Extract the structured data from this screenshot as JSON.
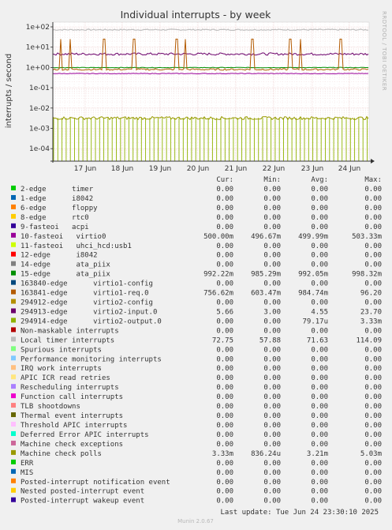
{
  "chart_data": {
    "type": "line",
    "title": "Individual interrupts - by week",
    "ylabel": "interrupts / second",
    "xlabel": "",
    "yscale": "log",
    "ylim": [
      3e-05,
      200
    ],
    "ytick_labels": [
      "1e+02",
      "1e+01",
      "1e+00",
      "1e-01",
      "1e-02",
      "1e-03",
      "1e-04"
    ],
    "ytick_values": [
      100,
      10,
      1,
      0.1,
      0.01,
      0.001,
      0.0001
    ],
    "categories": [
      "17 Jun",
      "18 Jun",
      "19 Jun",
      "20 Jun",
      "21 Jun",
      "22 Jun",
      "23 Jun",
      "24 Jun"
    ],
    "grid": true,
    "side_label": "RRDTOOL / TOBI OETIKER",
    "columns": [
      "Cur:",
      "Min:",
      "Avg:",
      "Max:"
    ],
    "series": [
      {
        "name": "2-edge      timer",
        "color": "#00cc00",
        "cur": "0.00",
        "min": "0.00",
        "avg": "0.00",
        "max": "0.00"
      },
      {
        "name": "1-edge      i8042",
        "color": "#0066b3",
        "cur": "0.00",
        "min": "0.00",
        "avg": "0.00",
        "max": "0.00"
      },
      {
        "name": "6-edge      floppy",
        "color": "#ff8000",
        "cur": "0.00",
        "min": "0.00",
        "avg": "0.00",
        "max": "0.00"
      },
      {
        "name": "8-edge      rtc0",
        "color": "#ffcc00",
        "cur": "0.00",
        "min": "0.00",
        "avg": "0.00",
        "max": "0.00"
      },
      {
        "name": "9-fasteoi   acpi",
        "color": "#330099",
        "cur": "0.00",
        "min": "0.00",
        "avg": "0.00",
        "max": "0.00"
      },
      {
        "name": "10-fasteoi   virtio0",
        "color": "#990099",
        "cur": "500.00m",
        "min": "496.67m",
        "avg": "499.99m",
        "max": "503.33m"
      },
      {
        "name": "11-fasteoi   uhci_hcd:usb1",
        "color": "#ccff00",
        "cur": "0.00",
        "min": "0.00",
        "avg": "0.00",
        "max": "0.00"
      },
      {
        "name": "12-edge      i8042",
        "color": "#ff0000",
        "cur": "0.00",
        "min": "0.00",
        "avg": "0.00",
        "max": "0.00"
      },
      {
        "name": "14-edge      ata_piix",
        "color": "#808080",
        "cur": "0.00",
        "min": "0.00",
        "avg": "0.00",
        "max": "0.00"
      },
      {
        "name": "15-edge      ata_piix",
        "color": "#008f00",
        "cur": "992.22m",
        "min": "985.29m",
        "avg": "992.05m",
        "max": "998.32m"
      },
      {
        "name": "163840-edge      virtio1-config",
        "color": "#00487d",
        "cur": "0.00",
        "min": "0.00",
        "avg": "0.00",
        "max": "0.00"
      },
      {
        "name": "163841-edge      virtio1-req.0",
        "color": "#b35a00",
        "cur": "756.62m",
        "min": "603.47m",
        "avg": "984.74m",
        "max": "96.20"
      },
      {
        "name": "294912-edge      virtio2-config",
        "color": "#b38f00",
        "cur": "0.00",
        "min": "0.00",
        "avg": "0.00",
        "max": "0.00"
      },
      {
        "name": "294913-edge      virtio2-input.0",
        "color": "#6b006b",
        "cur": "5.66",
        "min": "3.00",
        "avg": "4.55",
        "max": "23.70"
      },
      {
        "name": "294914-edge      virtio2-output.0",
        "color": "#8fb300",
        "cur": "0.00",
        "min": "0.00",
        "avg": "79.17u",
        "max": "3.33m"
      },
      {
        "name": "Non-maskable interrupts",
        "color": "#b30000",
        "cur": "0.00",
        "min": "0.00",
        "avg": "0.00",
        "max": "0.00"
      },
      {
        "name": "Local timer interrupts",
        "color": "#bebebe",
        "cur": "72.75",
        "min": "57.88",
        "avg": "71.63",
        "max": "114.09"
      },
      {
        "name": "Spurious interrupts",
        "color": "#80ff80",
        "cur": "0.00",
        "min": "0.00",
        "avg": "0.00",
        "max": "0.00"
      },
      {
        "name": "Performance monitoring interrupts",
        "color": "#80c9ff",
        "cur": "0.00",
        "min": "0.00",
        "avg": "0.00",
        "max": "0.00"
      },
      {
        "name": "IRQ work interrupts",
        "color": "#ffc080",
        "cur": "0.00",
        "min": "0.00",
        "avg": "0.00",
        "max": "0.00"
      },
      {
        "name": "APIC ICR read retries",
        "color": "#ffe680",
        "cur": "0.00",
        "min": "0.00",
        "avg": "0.00",
        "max": "0.00"
      },
      {
        "name": "Rescheduling interrupts",
        "color": "#aa80ff",
        "cur": "0.00",
        "min": "0.00",
        "avg": "0.00",
        "max": "0.00"
      },
      {
        "name": "Function call interrupts",
        "color": "#ee00cc",
        "cur": "0.00",
        "min": "0.00",
        "avg": "0.00",
        "max": "0.00"
      },
      {
        "name": "TLB shootdowns",
        "color": "#ff8080",
        "cur": "0.00",
        "min": "0.00",
        "avg": "0.00",
        "max": "0.00"
      },
      {
        "name": "Thermal event interrupts",
        "color": "#666600",
        "cur": "0.00",
        "min": "0.00",
        "avg": "0.00",
        "max": "0.00"
      },
      {
        "name": "Threshold APIC interrupts",
        "color": "#ffbfff",
        "cur": "0.00",
        "min": "0.00",
        "avg": "0.00",
        "max": "0.00"
      },
      {
        "name": "Deferred Error APIC interrupts",
        "color": "#00ffcc",
        "cur": "0.00",
        "min": "0.00",
        "avg": "0.00",
        "max": "0.00"
      },
      {
        "name": "Machine check exceptions",
        "color": "#cc6699",
        "cur": "0.00",
        "min": "0.00",
        "avg": "0.00",
        "max": "0.00"
      },
      {
        "name": "Machine check polls",
        "color": "#999900",
        "cur": "3.33m",
        "min": "836.24u",
        "avg": "3.21m",
        "max": "5.03m"
      },
      {
        "name": "ERR",
        "color": "#00cc00",
        "cur": "0.00",
        "min": "0.00",
        "avg": "0.00",
        "max": "0.00"
      },
      {
        "name": "MIS",
        "color": "#0066b3",
        "cur": "0.00",
        "min": "0.00",
        "avg": "0.00",
        "max": "0.00"
      },
      {
        "name": "Posted-interrupt notification event",
        "color": "#ff8000",
        "cur": "0.00",
        "min": "0.00",
        "avg": "0.00",
        "max": "0.00"
      },
      {
        "name": "Nested posted-interrupt event",
        "color": "#ffcc00",
        "cur": "0.00",
        "min": "0.00",
        "avg": "0.00",
        "max": "0.00"
      },
      {
        "name": "Posted-interrupt wakeup event",
        "color": "#330099",
        "cur": "0.00",
        "min": "0.00",
        "avg": "0.00",
        "max": "0.00"
      }
    ],
    "plotted_lines": [
      {
        "label": "Local timer interrupts",
        "level": 72,
        "color": "#bebebe"
      },
      {
        "label": "294913-edge virtio2-input.0",
        "level": 4.6,
        "color": "#6b006b"
      },
      {
        "label": "15-edge ata_piix",
        "level": 0.99,
        "color": "#008f00"
      },
      {
        "label": "163841-edge virtio1-req.0",
        "level": 0.8,
        "color": "#b35a00"
      },
      {
        "label": "10-fasteoi virtio0",
        "level": 0.5,
        "color": "#990099"
      },
      {
        "label": "Machine check polls",
        "level": 0.0032,
        "color": "#999900"
      }
    ]
  },
  "footer": {
    "last_update": "Last update: Tue Jun 24 23:30:10 2025",
    "munin": "Munin 2.0.67"
  }
}
